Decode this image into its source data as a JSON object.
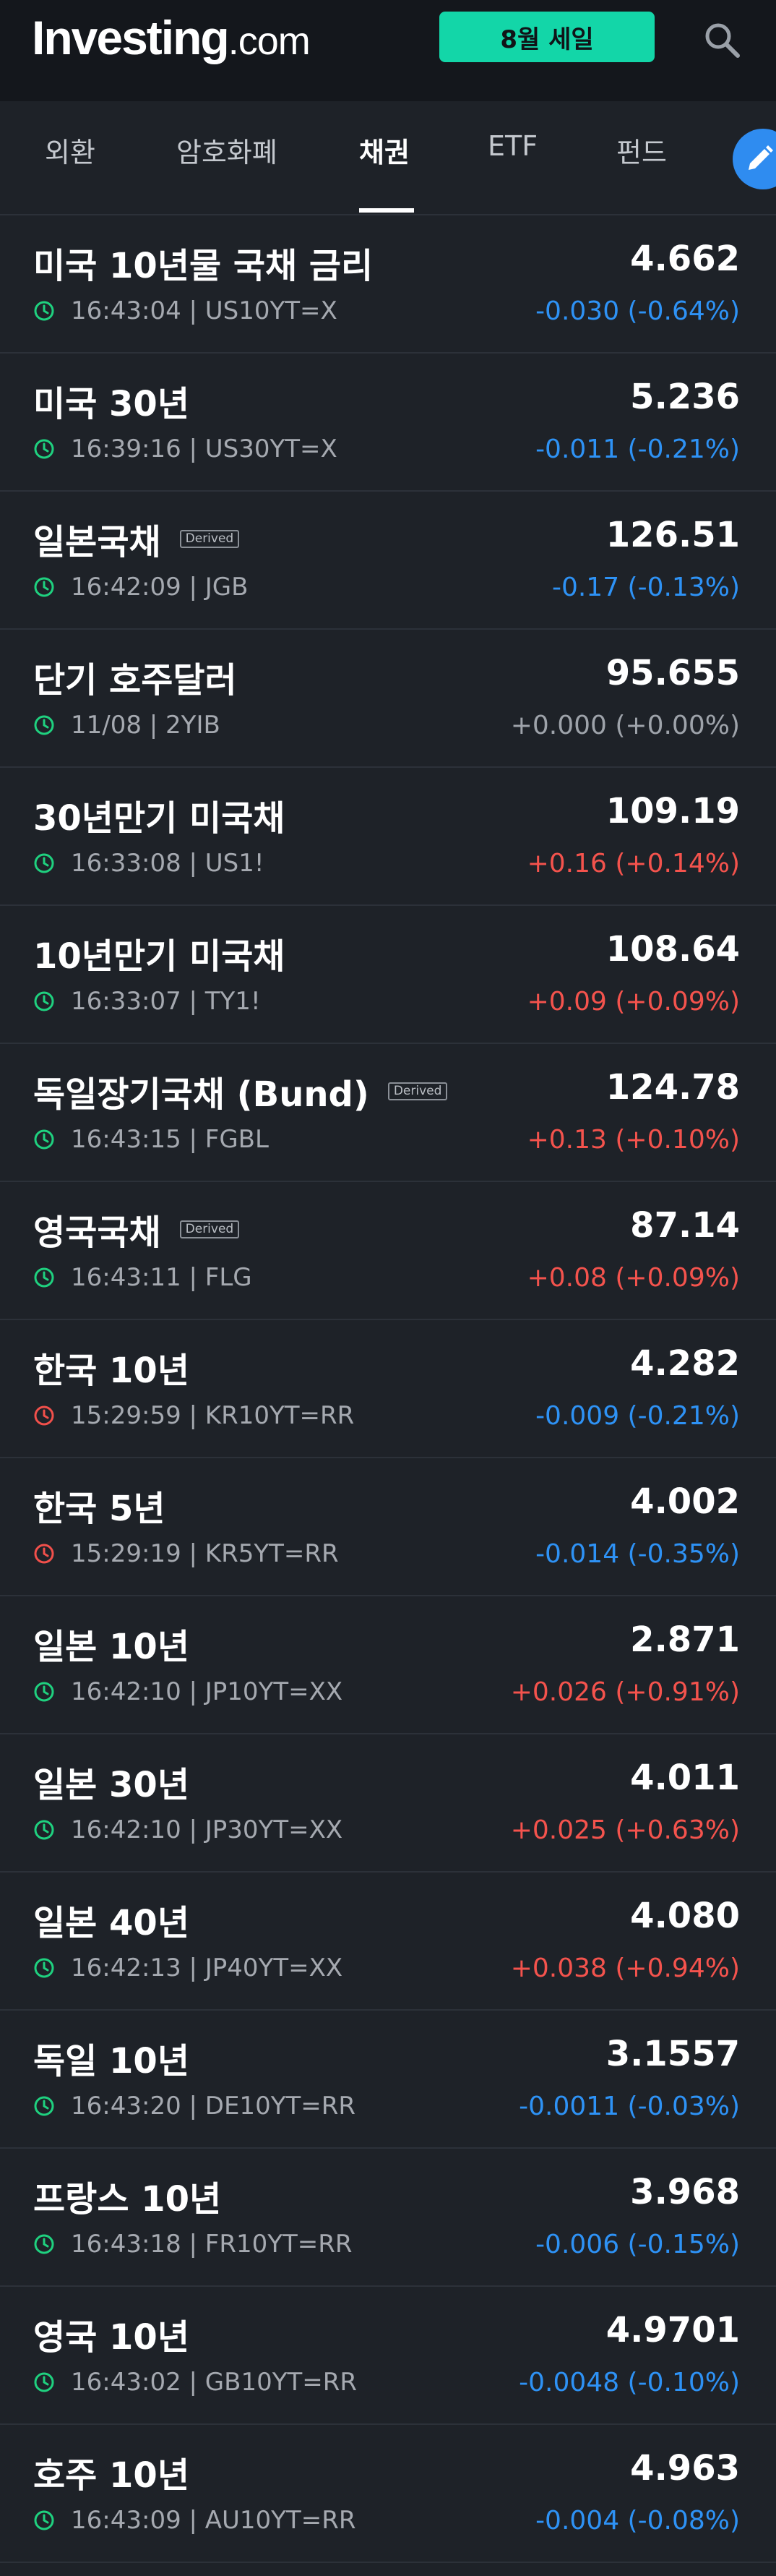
{
  "header": {
    "logo_brand": "Investing",
    "logo_tld": ".com",
    "sale_label": "8월 세일"
  },
  "tabs": [
    {
      "label": "외환"
    },
    {
      "label": "암호화폐"
    },
    {
      "label": "채권",
      "active": true
    },
    {
      "label": "ETF"
    },
    {
      "label": "펀드"
    }
  ],
  "colors": {
    "down": "#2e92f5",
    "up": "#f4534d",
    "flat": "#9ea3aa",
    "clock_open": "#1fd17f",
    "clock_closed": "#f2504b",
    "accent": "#13d6a8"
  },
  "instruments": [
    {
      "name": "미국 10년물 국채 금리",
      "badge": "",
      "price": "4.662",
      "time": "16:43:04",
      "symbol": "US10YT=X",
      "change": "-0.030 (-0.64%)",
      "direction": "down",
      "status": "open"
    },
    {
      "name": "미국 30년",
      "badge": "",
      "price": "5.236",
      "time": "16:39:16",
      "symbol": "US30YT=X",
      "change": "-0.011 (-0.21%)",
      "direction": "down",
      "status": "open"
    },
    {
      "name": "일본국채",
      "badge": "Derived",
      "price": "126.51",
      "time": "16:42:09",
      "symbol": "JGB",
      "change": "-0.17 (-0.13%)",
      "direction": "down",
      "status": "open"
    },
    {
      "name": "단기 호주달러",
      "badge": "",
      "price": "95.655",
      "time": "11/08",
      "symbol": "2YIB",
      "change": "+0.000 (+0.00%)",
      "direction": "flat",
      "status": "open"
    },
    {
      "name": "30년만기 미국채",
      "badge": "",
      "price": "109.19",
      "time": "16:33:08",
      "symbol": "US1!",
      "change": "+0.16 (+0.14%)",
      "direction": "up",
      "status": "open"
    },
    {
      "name": "10년만기 미국채",
      "badge": "",
      "price": "108.64",
      "time": "16:33:07",
      "symbol": "TY1!",
      "change": "+0.09 (+0.09%)",
      "direction": "up",
      "status": "open"
    },
    {
      "name": "독일장기국채 (Bund)",
      "badge": "Derived",
      "price": "124.78",
      "time": "16:43:15",
      "symbol": "FGBL",
      "change": "+0.13 (+0.10%)",
      "direction": "up",
      "status": "open"
    },
    {
      "name": "영국국채",
      "badge": "Derived",
      "price": "87.14",
      "time": "16:43:11",
      "symbol": "FLG",
      "change": "+0.08 (+0.09%)",
      "direction": "up",
      "status": "open"
    },
    {
      "name": "한국 10년",
      "badge": "",
      "price": "4.282",
      "time": "15:29:59",
      "symbol": "KR10YT=RR",
      "change": "-0.009 (-0.21%)",
      "direction": "down",
      "status": "closed"
    },
    {
      "name": "한국 5년",
      "badge": "",
      "price": "4.002",
      "time": "15:29:19",
      "symbol": "KR5YT=RR",
      "change": "-0.014 (-0.35%)",
      "direction": "down",
      "status": "closed"
    },
    {
      "name": "일본 10년",
      "badge": "",
      "price": "2.871",
      "time": "16:42:10",
      "symbol": "JP10YT=XX",
      "change": "+0.026 (+0.91%)",
      "direction": "up",
      "status": "open"
    },
    {
      "name": "일본 30년",
      "badge": "",
      "price": "4.011",
      "time": "16:42:10",
      "symbol": "JP30YT=XX",
      "change": "+0.025 (+0.63%)",
      "direction": "up",
      "status": "open"
    },
    {
      "name": "일본 40년",
      "badge": "",
      "price": "4.080",
      "time": "16:42:13",
      "symbol": "JP40YT=XX",
      "change": "+0.038 (+0.94%)",
      "direction": "up",
      "status": "open"
    },
    {
      "name": "독일 10년",
      "badge": "",
      "price": "3.1557",
      "time": "16:43:20",
      "symbol": "DE10YT=RR",
      "change": "-0.0011 (-0.03%)",
      "direction": "down",
      "status": "open"
    },
    {
      "name": "프랑스 10년",
      "badge": "",
      "price": "3.968",
      "time": "16:43:18",
      "symbol": "FR10YT=RR",
      "change": "-0.006 (-0.15%)",
      "direction": "down",
      "status": "open"
    },
    {
      "name": "영국 10년",
      "badge": "",
      "price": "4.9701",
      "time": "16:43:02",
      "symbol": "GB10YT=RR",
      "change": "-0.0048 (-0.10%)",
      "direction": "down",
      "status": "open"
    },
    {
      "name": "호주 10년",
      "badge": "",
      "price": "4.963",
      "time": "16:43:09",
      "symbol": "AU10YT=RR",
      "change": "-0.004 (-0.08%)",
      "direction": "down",
      "status": "open"
    }
  ]
}
